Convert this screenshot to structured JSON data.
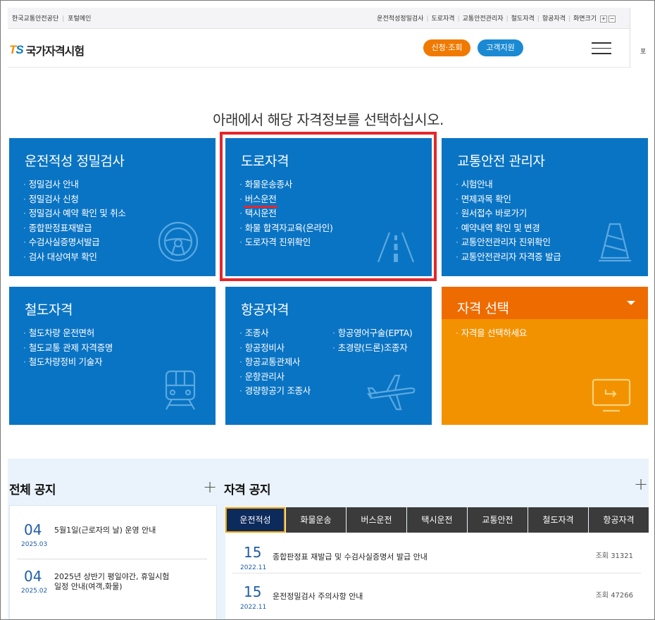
{
  "topbar": {
    "left_links": [
      "한국교통안전공단",
      "포털메인"
    ],
    "right_links": [
      "운전적성정밀검사",
      "도로자격",
      "교통안전관리자",
      "철도자격",
      "항공자격"
    ],
    "font_size_label": "화면크기",
    "font_plus": "+",
    "font_minus": "−",
    "side_text": "포"
  },
  "header": {
    "logo_t": "T",
    "logo_s": "S",
    "logo_name": "국가자격시험",
    "apply_button": "신청·조회",
    "support_button": "고객지원"
  },
  "headline": "아래에서 해당 자격정보를 선택하십시오.",
  "cards": {
    "driving_aptitude": {
      "title": "운전적성 정밀검사",
      "items": [
        "정밀검사 안내",
        "정밀검사 신청",
        "정밀검사 예약 확인 및 취소",
        "종합판정표재발급",
        "수검사실증명서발급",
        "검사 대상여부 확인"
      ],
      "icon": "steering-wheel-icon"
    },
    "road": {
      "title": "도로자격",
      "items": [
        "화물운송종사",
        "버스운전",
        "택시운전",
        "화물 합격자교육(온라인)",
        "도로자격 진위확인"
      ],
      "icon": "road-icon"
    },
    "traffic_safety": {
      "title": "교통안전 관리자",
      "items": [
        "시험안내",
        "면제과목 확인",
        "원서접수 바로가기",
        "예약내역 확인 및 변경",
        "교통안전관리자 진위확인",
        "교통안전관리자 자격증 발급"
      ],
      "icon": "traffic-cone-icon"
    },
    "railway": {
      "title": "철도자격",
      "items": [
        "철도차량 운전면허",
        "철도교통 관제 자격증명",
        "철도차량정비 기술자"
      ],
      "icon": "train-icon"
    },
    "aviation": {
      "title": "항공자격",
      "items_col1": [
        "조종사",
        "항공정비사",
        "항공교통관제사",
        "운항관리사",
        "경량항공기 조종사"
      ],
      "items_col2": [
        "항공영어구술(EPTA)",
        "초경량(드론)조종자"
      ],
      "icon": "airplane-icon"
    },
    "select": {
      "title": "자격 선택",
      "items": [
        "자격을 선택하세요"
      ],
      "icon": "monitor-icon"
    }
  },
  "notices": {
    "all_title": "전체 공지",
    "all_items": [
      {
        "day": "04",
        "ym": "2025.03",
        "text": "5월1일(근로자의 날) 운영 안내"
      },
      {
        "day": "04",
        "ym": "2025.02",
        "text": "2025년 상반기 평일야간, 휴일시험 일정 안내(여객,화물)"
      }
    ],
    "qual_title": "자격 공지",
    "tabs": [
      "운전적성",
      "화물운송",
      "버스운전",
      "택시운전",
      "교통안전",
      "철도자격",
      "항공자격"
    ],
    "qual_items": [
      {
        "day": "15",
        "ym": "2022.11",
        "text": "종합판정표 재발급 및 수검사실증명서 발급 안내",
        "views": "조회 31321"
      },
      {
        "day": "15",
        "ym": "2022.11",
        "text": "운전정밀검사 주의사항 안내",
        "views": "조회 47266"
      }
    ]
  }
}
